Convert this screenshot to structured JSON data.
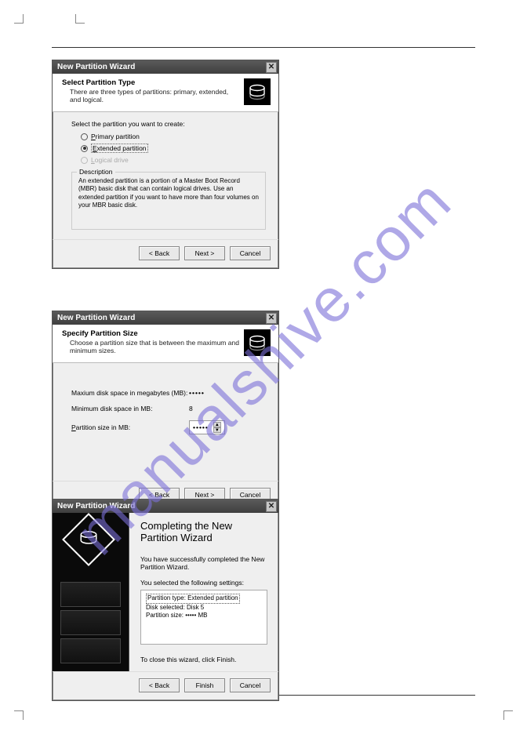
{
  "watermark": "manualshive.com",
  "dialog1": {
    "title": "New Partition Wizard",
    "header_title": "Select Partition Type",
    "header_sub": "There are three types of partitions: primary, extended, and logical.",
    "prompt": "Select the partition you want to create:",
    "opt_primary": "Primary partition",
    "opt_extended": "Extended partition",
    "opt_logical": "Logical drive",
    "desc_label": "Description",
    "desc_text": "An extended partition is a portion of a Master Boot Record (MBR) basic disk that can contain logical drives. Use an extended partition if you want to have more than four volumes on your MBR basic disk.",
    "back": "< Back",
    "next": "Next >",
    "cancel": "Cancel"
  },
  "dialog2": {
    "title": "New Partition Wizard",
    "header_title": "Specify Partition Size",
    "header_sub": "Choose a partition size that is between the maximum and minimum sizes.",
    "max_label": "Maxium disk space in megabytes (MB):",
    "max_val": "•••••",
    "min_label": "Minimum disk space in MB:",
    "min_val": "8",
    "size_label": "Partition size in MB:",
    "size_val": "•••••",
    "back": "< Back",
    "next": "Next >",
    "cancel": "Cancel"
  },
  "dialog3": {
    "title": "New Partition Wizard",
    "comp_title": "Completing the New Partition Wizard",
    "success": "You have successfully completed the New Partition Wizard.",
    "selected": "You selected the following settings:",
    "s1": "Partition type: Extended partition",
    "s2": "Disk selected: Disk 5",
    "s3": "Partition size: ••••• MB",
    "close_hint": "To close this wizard, click Finish.",
    "back": "< Back",
    "finish": "Finish",
    "cancel": "Cancel"
  }
}
